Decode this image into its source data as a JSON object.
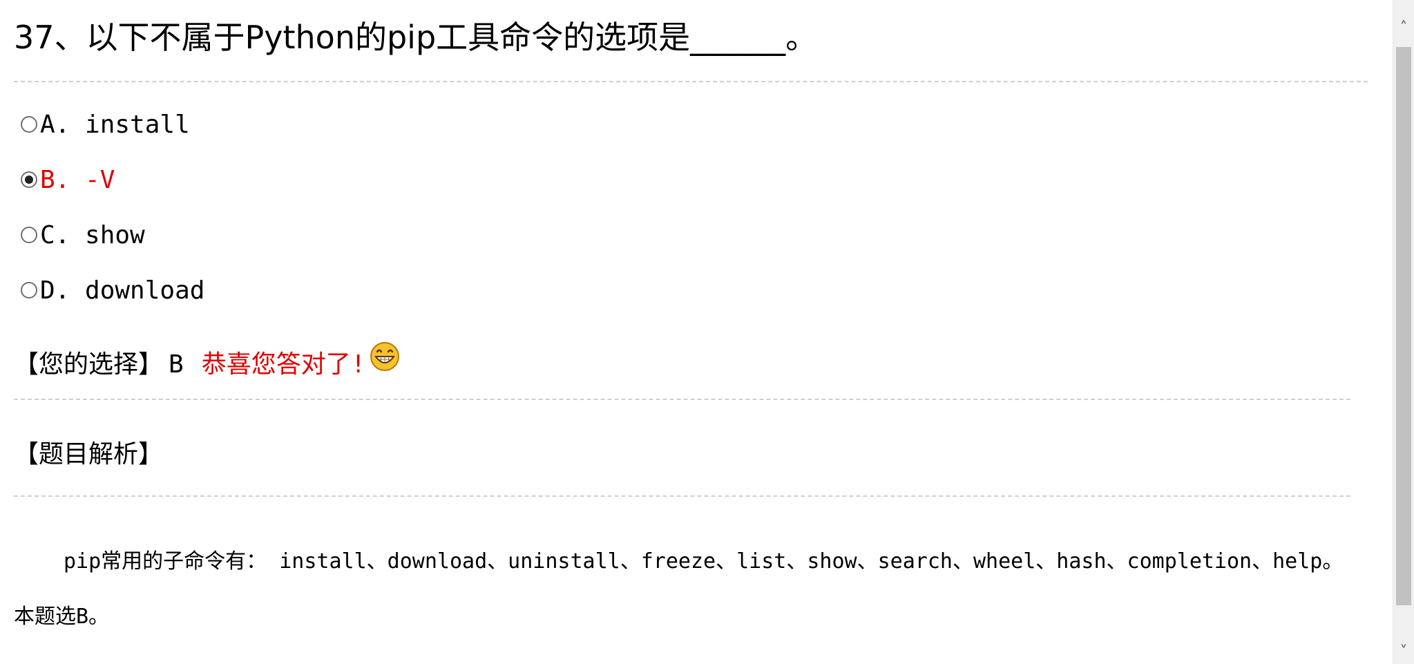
{
  "question": {
    "title": "37、以下不属于Python的pip工具命令的选项是______。"
  },
  "options": [
    {
      "label": "A. install",
      "selected": false,
      "correct": false
    },
    {
      "label": "B. -V",
      "selected": true,
      "correct": true
    },
    {
      "label": "C. show",
      "selected": false,
      "correct": false
    },
    {
      "label": "D. download",
      "selected": false,
      "correct": false
    }
  ],
  "result": {
    "choice_label": "【您的选择】",
    "choice_value": "B",
    "feedback": "恭喜您答对了!",
    "feedback_icon": "grinning-smiley-icon",
    "feedback_color": "#e00000"
  },
  "analysis": {
    "title": "【题目解析】",
    "body": "pip常用的子命令有： install、download、uninstall、freeze、list、show、search、wheel、hash、completion、help。本题选B。"
  },
  "colors": {
    "correct": "#e00000",
    "divider": "#cfcfcf"
  }
}
